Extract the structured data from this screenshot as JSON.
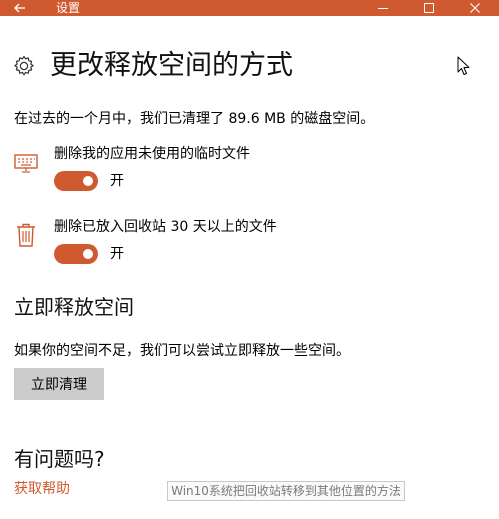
{
  "window": {
    "title": "设置",
    "accent_color": "#d05a30"
  },
  "header": {
    "icon": "gear-icon",
    "title": "更改释放空间的方式"
  },
  "summary_text": "在过去的一个月中，我们已清理了 89.6 MB 的磁盘空间。",
  "settings": [
    {
      "icon": "keyboard-icon",
      "label": "删除我的应用未使用的临时文件",
      "toggle_on": true,
      "state_label": "开"
    },
    {
      "icon": "trash-icon",
      "label": "删除已放入回收站 30 天以上的文件",
      "toggle_on": true,
      "state_label": "开"
    }
  ],
  "free_now": {
    "title": "立即释放空间",
    "description": "如果你的空间不足，我们可以尝试立即释放一些空间。",
    "button_label": "立即清理"
  },
  "help": {
    "title": "有问题吗?",
    "link_label": "获取帮助"
  },
  "watermark_text": "Win10系统把回收站转移到其他位置的方法"
}
